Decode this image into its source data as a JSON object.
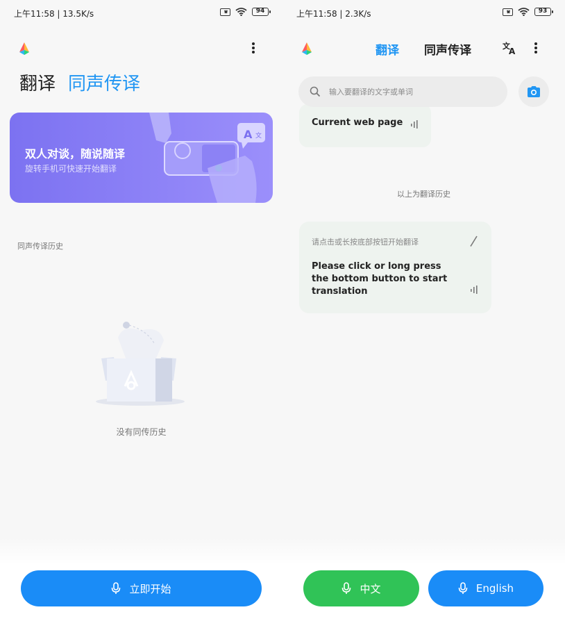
{
  "left": {
    "status": {
      "text": "上午11:58 | 13.5K/s",
      "battery": "94"
    },
    "tabs": [
      {
        "label": "翻译",
        "active": false
      },
      {
        "label": "同声传译",
        "active": true
      }
    ],
    "banner": {
      "title": "双人对谈，随说随译",
      "subtitle": "旋转手机可快速开始翻译"
    },
    "history_label": "同声传译历史",
    "empty_text": "没有同传历史",
    "start_button": "立即开始"
  },
  "right": {
    "status": {
      "text": "上午11:58 | 2.3K/s",
      "battery": "93"
    },
    "tabs": [
      {
        "label": "翻译",
        "active": true
      },
      {
        "label": "同声传译",
        "active": false
      }
    ],
    "search": {
      "placeholder": "输入要翻译的文字或单词"
    },
    "previous_card": {
      "text": "Current web page"
    },
    "history_end": "以上为翻译历史",
    "hint_card": {
      "label": "请点击或长按底部按钮开始翻译",
      "body": "Please click or long press the bottom button to start translation"
    },
    "buttons": {
      "chinese": "中文",
      "english": "English"
    }
  },
  "colors": {
    "accent": "#2196f3",
    "button_blue": "#1a8cf7",
    "button_green": "#30c357",
    "banner": "#8a80f6"
  },
  "icons": [
    "app-logo-icon",
    "more-icon",
    "search-icon",
    "camera-icon",
    "translate-swap-icon",
    "mic-icon",
    "pen-icon",
    "wifi-icon",
    "sim-icon",
    "battery-icon"
  ]
}
